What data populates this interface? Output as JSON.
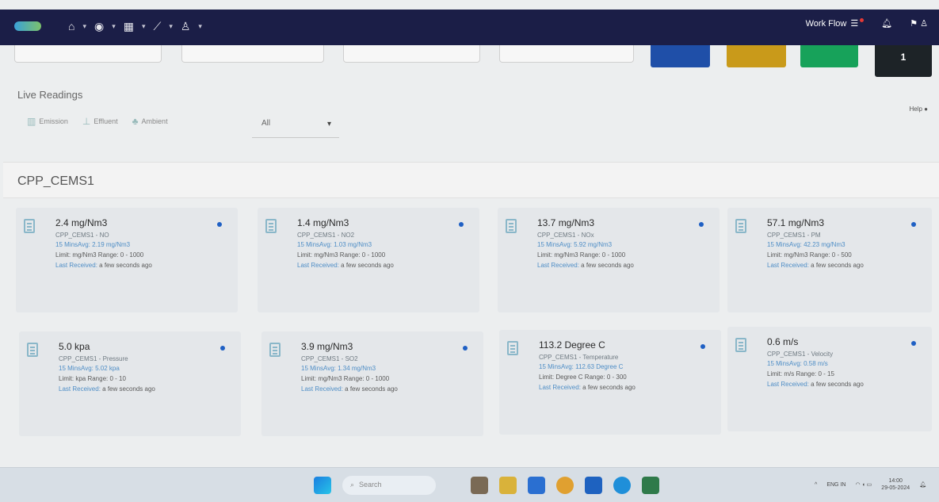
{
  "navbar": {
    "icons": [
      "app-logo",
      "home-icon",
      "globe-icon",
      "chart-icon",
      "line-chart-icon",
      "user-icon"
    ],
    "workflow_label": "Work Flow",
    "right_icons": [
      "bell-icon",
      "flag-icon",
      "user-icon"
    ]
  },
  "summary": {
    "boxes": [
      "",
      "",
      "",
      ""
    ],
    "dark_box_value": "1",
    "colors": [
      "#1f4fa8",
      "#c99a1a",
      "#17a25a",
      "#1d2327"
    ]
  },
  "live": {
    "title": "Live Readings",
    "filters": [
      {
        "label": "Emission",
        "icon": "factory-icon"
      },
      {
        "label": "Effluent",
        "icon": "drop-icon"
      },
      {
        "label": "Ambient",
        "icon": "tree-icon"
      }
    ],
    "select_value": "All",
    "help_label": "Help"
  },
  "section": {
    "title": "CPP_CEMS1"
  },
  "cards": [
    {
      "value": "2.4 mg/Nm3",
      "name": "CPP_CEMS1 - NO",
      "avg": "15 MinsAvg: 2.19 mg/Nm3",
      "limit": "Limit: mg/Nm3 Range: 0 - 1000",
      "last_label": "Last Received:",
      "last_value": "a few seconds ago"
    },
    {
      "value": "1.4 mg/Nm3",
      "name": "CPP_CEMS1 - NO2",
      "avg": "15 MinsAvg: 1.03 mg/Nm3",
      "limit": "Limit: mg/Nm3 Range: 0 - 1000",
      "last_label": "Last Received:",
      "last_value": "a few seconds ago"
    },
    {
      "value": "13.7 mg/Nm3",
      "name": "CPP_CEMS1 - NOx",
      "avg": "15 MinsAvg: 5.92 mg/Nm3",
      "limit": "Limit: mg/Nm3 Range: 0 - 1000",
      "last_label": "Last Received:",
      "last_value": "a few seconds ago"
    },
    {
      "value": "57.1 mg/Nm3",
      "name": "CPP_CEMS1 - PM",
      "avg": "15 MinsAvg: 42.23 mg/Nm3",
      "limit": "Limit: mg/Nm3 Range: 0 - 500",
      "last_label": "Last Received:",
      "last_value": "a few seconds ago"
    },
    {
      "value": "5.0 kpa",
      "name": "CPP_CEMS1 - Pressure",
      "avg": "15 MinsAvg: 5.02 kpa",
      "limit": "Limit: kpa Range: 0 - 10",
      "last_label": "Last Received:",
      "last_value": "a few seconds ago"
    },
    {
      "value": "3.9 mg/Nm3",
      "name": "CPP_CEMS1 - SO2",
      "avg": "15 MinsAvg: 1.34 mg/Nm3",
      "limit": "Limit: mg/Nm3 Range: 0 - 1000",
      "last_label": "Last Received:",
      "last_value": "a few seconds ago"
    },
    {
      "value": "113.2 Degree C",
      "name": "CPP_CEMS1 - Temperature",
      "avg": "15 MinsAvg: 112.63 Degree C",
      "limit": "Limit: Degree C Range: 0 - 300",
      "last_label": "Last Received:",
      "last_value": "a few seconds ago"
    },
    {
      "value": "0.6 m/s",
      "name": "CPP_CEMS1 - Velocity",
      "avg": "15 MinsAvg: 0.58 m/s",
      "limit": "Limit: m/s Range: 0 - 15",
      "last_label": "Last Received:",
      "last_value": "a few seconds ago"
    }
  ],
  "taskbar": {
    "search_placeholder": "Search",
    "tray_lang": "ENG IN",
    "clock_time": "14:00",
    "clock_date": "29-05-2024"
  }
}
